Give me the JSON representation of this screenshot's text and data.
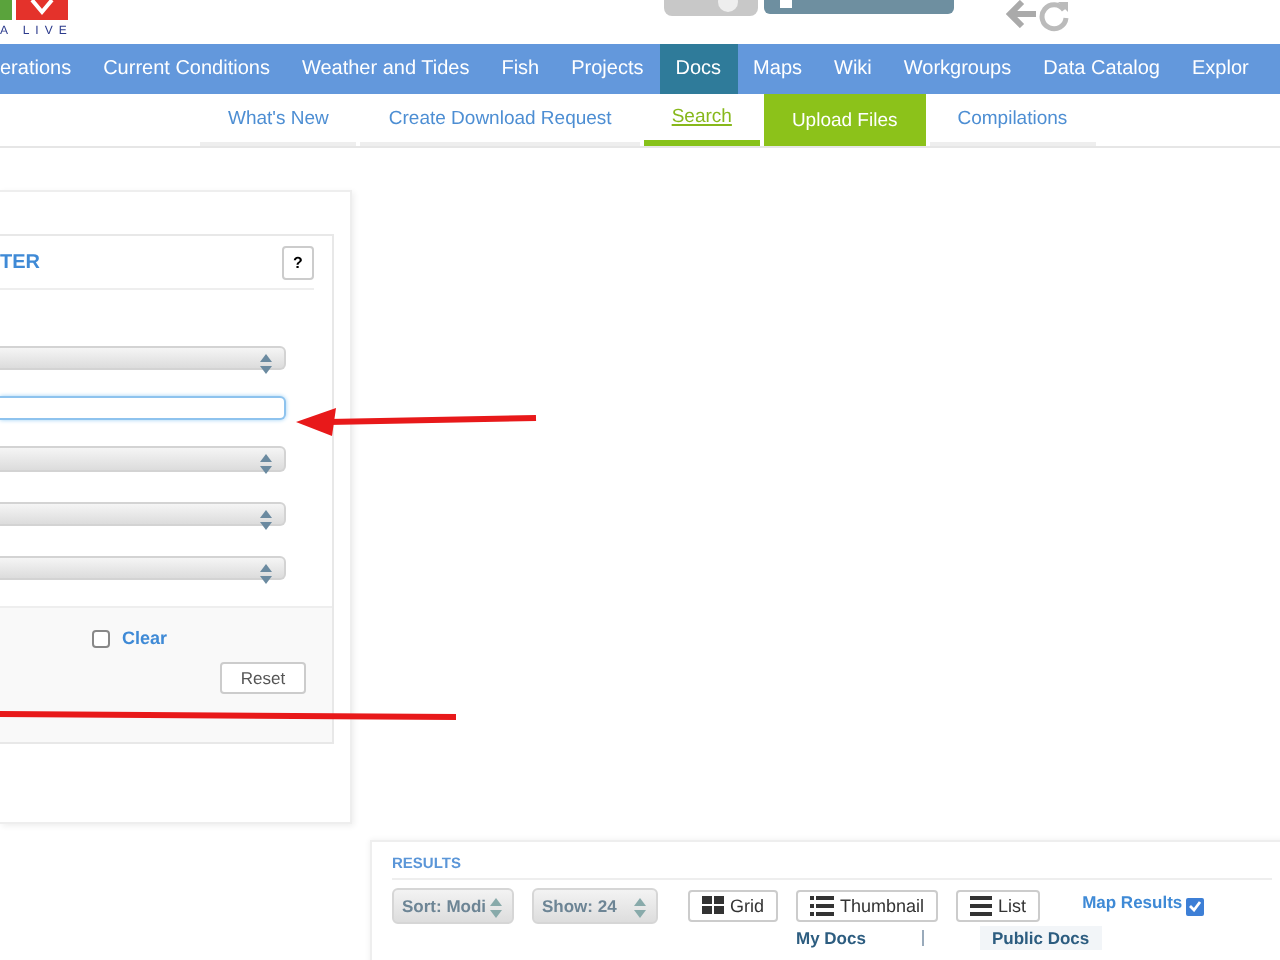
{
  "header": {
    "logo_text": "A LIVE",
    "toggle": {
      "on": true
    }
  },
  "nav": [
    {
      "label": "erations",
      "selected": false
    },
    {
      "label": "Current Conditions",
      "selected": false
    },
    {
      "label": "Weather and Tides",
      "selected": false
    },
    {
      "label": "Fish",
      "selected": false
    },
    {
      "label": "Projects",
      "selected": false
    },
    {
      "label": "Docs",
      "selected": true
    },
    {
      "label": "Maps",
      "selected": false
    },
    {
      "label": "Wiki",
      "selected": false
    },
    {
      "label": "Workgroups",
      "selected": false
    },
    {
      "label": "Data Catalog",
      "selected": false
    },
    {
      "label": "Explor",
      "selected": false
    }
  ],
  "subnav": [
    {
      "label": "What's New",
      "kind": "link",
      "selected": false
    },
    {
      "label": "Create Download Request",
      "kind": "link",
      "selected": false
    },
    {
      "label": "Search",
      "kind": "link",
      "selected": true
    },
    {
      "label": "Upload Files",
      "kind": "button",
      "selected": false
    },
    {
      "label": "Compilations",
      "kind": "link",
      "selected": false
    }
  ],
  "filter": {
    "title": "TER",
    "help": "?",
    "fields": [
      {
        "kind": "select",
        "focused": false
      },
      {
        "kind": "input",
        "focused": true
      },
      {
        "kind": "select",
        "focused": false
      },
      {
        "kind": "select",
        "focused": false
      },
      {
        "kind": "select",
        "focused": false
      }
    ],
    "clear": {
      "label": "Clear",
      "checked": false
    },
    "reset": "Reset"
  },
  "results": {
    "title": "RESULTS",
    "sort": "Sort: Modi",
    "show": "Show: 24",
    "views": [
      {
        "label": "Grid",
        "kind": "grid"
      },
      {
        "label": "Thumbnail",
        "kind": "thumbnail"
      },
      {
        "label": "List",
        "kind": "list"
      }
    ],
    "map_results": {
      "label": "Map Results",
      "checked": true
    },
    "tabs": [
      {
        "label": "My Docs",
        "selected": false
      },
      {
        "label": "Public Docs",
        "selected": true
      }
    ]
  }
}
